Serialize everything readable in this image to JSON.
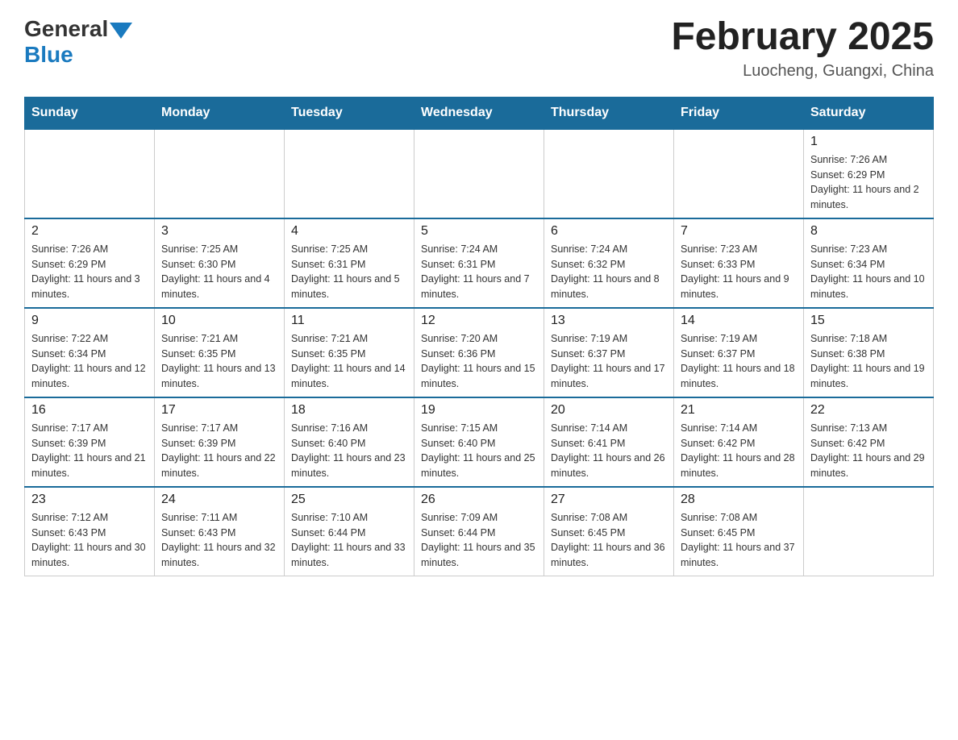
{
  "logo": {
    "general": "General",
    "blue": "Blue"
  },
  "title": {
    "month_year": "February 2025",
    "location": "Luocheng, Guangxi, China"
  },
  "days_of_week": [
    "Sunday",
    "Monday",
    "Tuesday",
    "Wednesday",
    "Thursday",
    "Friday",
    "Saturday"
  ],
  "weeks": [
    {
      "days": [
        {
          "num": "",
          "info": ""
        },
        {
          "num": "",
          "info": ""
        },
        {
          "num": "",
          "info": ""
        },
        {
          "num": "",
          "info": ""
        },
        {
          "num": "",
          "info": ""
        },
        {
          "num": "",
          "info": ""
        },
        {
          "num": "1",
          "info": "Sunrise: 7:26 AM\nSunset: 6:29 PM\nDaylight: 11 hours and 2 minutes."
        }
      ]
    },
    {
      "days": [
        {
          "num": "2",
          "info": "Sunrise: 7:26 AM\nSunset: 6:29 PM\nDaylight: 11 hours and 3 minutes."
        },
        {
          "num": "3",
          "info": "Sunrise: 7:25 AM\nSunset: 6:30 PM\nDaylight: 11 hours and 4 minutes."
        },
        {
          "num": "4",
          "info": "Sunrise: 7:25 AM\nSunset: 6:31 PM\nDaylight: 11 hours and 5 minutes."
        },
        {
          "num": "5",
          "info": "Sunrise: 7:24 AM\nSunset: 6:31 PM\nDaylight: 11 hours and 7 minutes."
        },
        {
          "num": "6",
          "info": "Sunrise: 7:24 AM\nSunset: 6:32 PM\nDaylight: 11 hours and 8 minutes."
        },
        {
          "num": "7",
          "info": "Sunrise: 7:23 AM\nSunset: 6:33 PM\nDaylight: 11 hours and 9 minutes."
        },
        {
          "num": "8",
          "info": "Sunrise: 7:23 AM\nSunset: 6:34 PM\nDaylight: 11 hours and 10 minutes."
        }
      ]
    },
    {
      "days": [
        {
          "num": "9",
          "info": "Sunrise: 7:22 AM\nSunset: 6:34 PM\nDaylight: 11 hours and 12 minutes."
        },
        {
          "num": "10",
          "info": "Sunrise: 7:21 AM\nSunset: 6:35 PM\nDaylight: 11 hours and 13 minutes."
        },
        {
          "num": "11",
          "info": "Sunrise: 7:21 AM\nSunset: 6:35 PM\nDaylight: 11 hours and 14 minutes."
        },
        {
          "num": "12",
          "info": "Sunrise: 7:20 AM\nSunset: 6:36 PM\nDaylight: 11 hours and 15 minutes."
        },
        {
          "num": "13",
          "info": "Sunrise: 7:19 AM\nSunset: 6:37 PM\nDaylight: 11 hours and 17 minutes."
        },
        {
          "num": "14",
          "info": "Sunrise: 7:19 AM\nSunset: 6:37 PM\nDaylight: 11 hours and 18 minutes."
        },
        {
          "num": "15",
          "info": "Sunrise: 7:18 AM\nSunset: 6:38 PM\nDaylight: 11 hours and 19 minutes."
        }
      ]
    },
    {
      "days": [
        {
          "num": "16",
          "info": "Sunrise: 7:17 AM\nSunset: 6:39 PM\nDaylight: 11 hours and 21 minutes."
        },
        {
          "num": "17",
          "info": "Sunrise: 7:17 AM\nSunset: 6:39 PM\nDaylight: 11 hours and 22 minutes."
        },
        {
          "num": "18",
          "info": "Sunrise: 7:16 AM\nSunset: 6:40 PM\nDaylight: 11 hours and 23 minutes."
        },
        {
          "num": "19",
          "info": "Sunrise: 7:15 AM\nSunset: 6:40 PM\nDaylight: 11 hours and 25 minutes."
        },
        {
          "num": "20",
          "info": "Sunrise: 7:14 AM\nSunset: 6:41 PM\nDaylight: 11 hours and 26 minutes."
        },
        {
          "num": "21",
          "info": "Sunrise: 7:14 AM\nSunset: 6:42 PM\nDaylight: 11 hours and 28 minutes."
        },
        {
          "num": "22",
          "info": "Sunrise: 7:13 AM\nSunset: 6:42 PM\nDaylight: 11 hours and 29 minutes."
        }
      ]
    },
    {
      "days": [
        {
          "num": "23",
          "info": "Sunrise: 7:12 AM\nSunset: 6:43 PM\nDaylight: 11 hours and 30 minutes."
        },
        {
          "num": "24",
          "info": "Sunrise: 7:11 AM\nSunset: 6:43 PM\nDaylight: 11 hours and 32 minutes."
        },
        {
          "num": "25",
          "info": "Sunrise: 7:10 AM\nSunset: 6:44 PM\nDaylight: 11 hours and 33 minutes."
        },
        {
          "num": "26",
          "info": "Sunrise: 7:09 AM\nSunset: 6:44 PM\nDaylight: 11 hours and 35 minutes."
        },
        {
          "num": "27",
          "info": "Sunrise: 7:08 AM\nSunset: 6:45 PM\nDaylight: 11 hours and 36 minutes."
        },
        {
          "num": "28",
          "info": "Sunrise: 7:08 AM\nSunset: 6:45 PM\nDaylight: 11 hours and 37 minutes."
        },
        {
          "num": "",
          "info": ""
        }
      ]
    }
  ]
}
